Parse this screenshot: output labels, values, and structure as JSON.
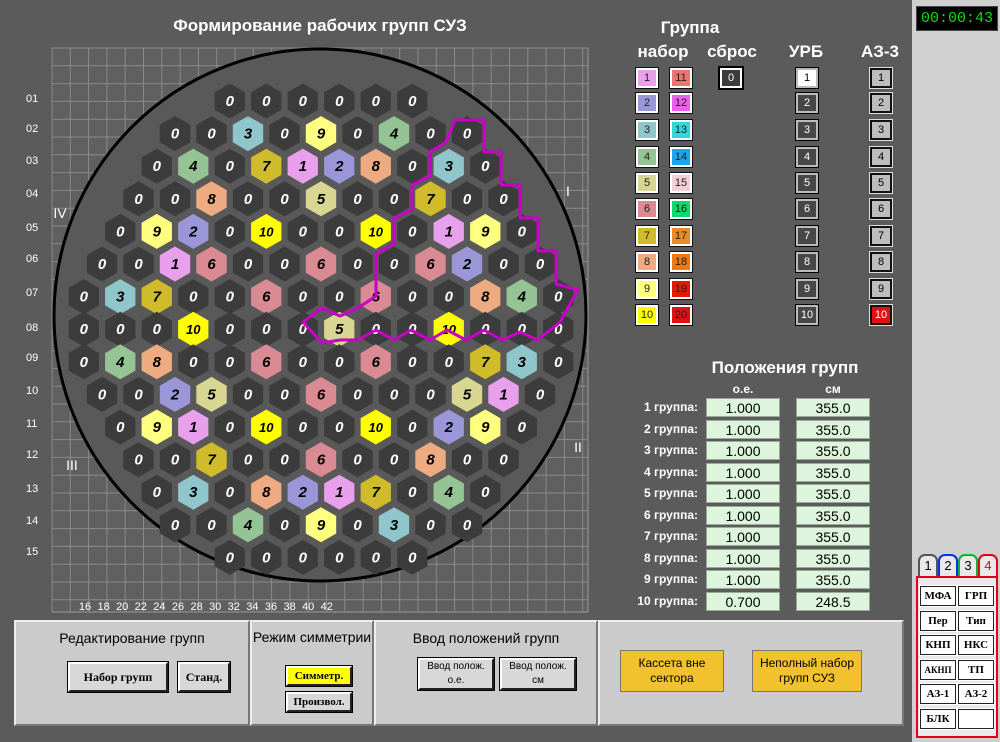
{
  "title": "Формирование рабочих групп СУЗ",
  "map": {
    "row_labels": [
      "01",
      "02",
      "03",
      "04",
      "05",
      "06",
      "07",
      "08",
      "09",
      "10",
      "11",
      "12",
      "13",
      "14",
      "15"
    ],
    "col_labels": [
      "16",
      "18",
      "20",
      "22",
      "24",
      "26",
      "28",
      "30",
      "32",
      "34",
      "36",
      "38",
      "40",
      "42"
    ],
    "sector_labels": {
      "I": "I",
      "II": "II",
      "III": "III",
      "IV": "IV"
    },
    "colors": {
      "0": "#3c3c3c",
      "1": "#e9a0ec",
      "2": "#9a96d8",
      "3": "#8ec6cc",
      "4": "#94c494",
      "5": "#d8d690",
      "6": "#d98a92",
      "7": "#d0bc2a",
      "8": "#eeaa80",
      "9": "#ffff80",
      "10": "#ffff00"
    },
    "highlight_color": "#c800c8",
    "rows": [
      [
        0,
        0,
        0,
        0,
        0,
        0
      ],
      [
        0,
        0,
        3,
        0,
        9,
        0,
        4,
        0,
        0
      ],
      [
        0,
        4,
        0,
        7,
        1,
        2,
        8,
        0,
        3,
        0
      ],
      [
        0,
        0,
        8,
        0,
        0,
        5,
        0,
        0,
        7,
        0,
        0
      ],
      [
        0,
        9,
        2,
        0,
        10,
        0,
        0,
        10,
        0,
        1,
        9,
        0
      ],
      [
        0,
        0,
        1,
        6,
        0,
        0,
        6,
        0,
        0,
        6,
        2,
        0,
        0
      ],
      [
        0,
        3,
        7,
        0,
        0,
        6,
        0,
        0,
        6,
        0,
        0,
        8,
        4,
        0
      ],
      [
        0,
        0,
        0,
        10,
        0,
        0,
        0,
        5,
        0,
        0,
        10,
        0,
        0,
        0
      ],
      [
        0,
        4,
        8,
        0,
        0,
        6,
        0,
        0,
        6,
        0,
        0,
        7,
        3,
        0
      ],
      [
        0,
        0,
        2,
        5,
        0,
        0,
        6,
        0,
        0,
        0,
        5,
        1,
        0
      ],
      [
        0,
        9,
        1,
        0,
        10,
        0,
        0,
        10,
        0,
        2,
        9,
        0
      ],
      [
        0,
        0,
        7,
        0,
        0,
        6,
        0,
        0,
        8,
        0,
        0
      ],
      [
        0,
        3,
        0,
        8,
        2,
        1,
        7,
        0,
        4,
        0
      ],
      [
        0,
        0,
        4,
        0,
        9,
        0,
        3,
        0,
        0
      ],
      [
        0,
        0,
        0,
        0,
        0,
        0
      ]
    ]
  },
  "groups": {
    "title": "Группа",
    "headers": {
      "nabor": "набор",
      "sbros": "сброс",
      "urb": "УРБ",
      "az3": "АЗ-3"
    },
    "nabor": [
      {
        "label": "1",
        "color": "#e9a0ec"
      },
      {
        "label": "2",
        "color": "#9a96d8"
      },
      {
        "label": "3",
        "color": "#8ec6cc"
      },
      {
        "label": "4",
        "color": "#94c494"
      },
      {
        "label": "5",
        "color": "#d8d690"
      },
      {
        "label": "6",
        "color": "#d98a92"
      },
      {
        "label": "7",
        "color": "#d0bc2a"
      },
      {
        "label": "8",
        "color": "#eeaa80"
      },
      {
        "label": "9",
        "color": "#ffff80"
      },
      {
        "label": "10",
        "color": "#ffff00"
      }
    ],
    "nabor2": [
      {
        "label": "11",
        "color": "#ee7474"
      },
      {
        "label": "12",
        "color": "#ea60ea"
      },
      {
        "label": "13",
        "color": "#30d8dc"
      },
      {
        "label": "14",
        "color": "#1aa6ec"
      },
      {
        "label": "15",
        "color": "#f6d0d8"
      },
      {
        "label": "16",
        "color": "#10d86c"
      },
      {
        "label": "17",
        "color": "#e88c28"
      },
      {
        "label": "18",
        "color": "#f07a10"
      },
      {
        "label": "19",
        "color": "#e01c00"
      },
      {
        "label": "20",
        "color": "#e21010"
      }
    ],
    "sbros": "0",
    "urb": [
      "1",
      "2",
      "3",
      "4",
      "5",
      "6",
      "7",
      "8",
      "9",
      "10"
    ],
    "az3": [
      "1",
      "2",
      "3",
      "4",
      "5",
      "6",
      "7",
      "8",
      "9",
      "10"
    ]
  },
  "positions": {
    "title": "Положения групп",
    "col_oe": "о.е.",
    "col_cm": "см",
    "rows": [
      {
        "label": "1 группа:",
        "oe": "1.000",
        "cm": "355.0"
      },
      {
        "label": "2 группа:",
        "oe": "1.000",
        "cm": "355.0"
      },
      {
        "label": "3 группа:",
        "oe": "1.000",
        "cm": "355.0"
      },
      {
        "label": "4 группа:",
        "oe": "1.000",
        "cm": "355.0"
      },
      {
        "label": "5 группа:",
        "oe": "1.000",
        "cm": "355.0"
      },
      {
        "label": "6 группа:",
        "oe": "1.000",
        "cm": "355.0"
      },
      {
        "label": "7 группа:",
        "oe": "1.000",
        "cm": "355.0"
      },
      {
        "label": "8 группа:",
        "oe": "1.000",
        "cm": "355.0"
      },
      {
        "label": "9 группа:",
        "oe": "1.000",
        "cm": "355.0"
      },
      {
        "label": "10 группа:",
        "oe": "0.700",
        "cm": "248.5"
      }
    ]
  },
  "bottom": {
    "edit_title": "Редактирование групп",
    "btn_nabor": "Набор групп",
    "btn_stand": "Станд.",
    "sym_title": "Режим симметрии",
    "btn_symm": "Симметр.",
    "btn_proizv": "Произвол.",
    "input_title": "Ввод положений групп",
    "btn_oe": "Ввод полож. о.е.",
    "btn_cm": "Ввод полож. см",
    "btn_kasseta": "Кассета вне сектора",
    "btn_nepolny": "Неполный набор групп СУЗ"
  },
  "sidebar": {
    "clock": "00:00:43",
    "tabs": [
      {
        "label": "1",
        "color": "#555555"
      },
      {
        "label": "2",
        "color": "#1030e0"
      },
      {
        "label": "3",
        "color": "#10b040"
      },
      {
        "label": "4",
        "color": "#e00020"
      }
    ],
    "buttons": [
      {
        "left": "МФА",
        "right": "ГРП"
      },
      {
        "left": "Пер",
        "right": "Тип"
      },
      {
        "left": "КНП",
        "right": "НКС"
      },
      {
        "left": "АКНП",
        "right": "ТП"
      },
      {
        "left": "АЗ-1",
        "right": "АЗ-2"
      },
      {
        "left": "БЛК",
        "right": ""
      }
    ]
  }
}
